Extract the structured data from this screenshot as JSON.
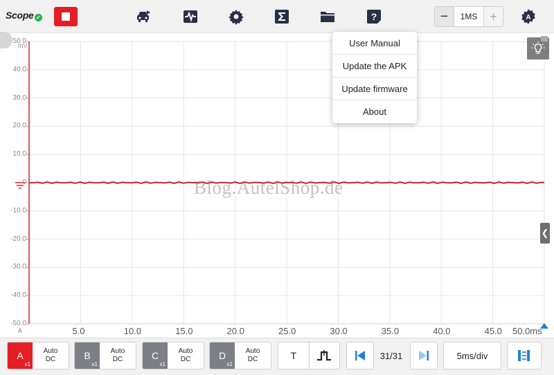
{
  "app": {
    "title": "Scope"
  },
  "colors": {
    "accent_red": "#e51d25",
    "trace": "#c8232c",
    "channel_gray": "#7d7f86",
    "icon_dark": "#2b2f45",
    "nav_blue": "#1f7fdc"
  },
  "toolbar": {
    "icons": [
      "stop-icon",
      "vehicle-icon",
      "waveform-icon",
      "gear-icon",
      "sigma-icon",
      "folder-icon",
      "help-icon",
      "settings-badge-icon"
    ],
    "sample_rate": {
      "minus": "−",
      "value": "1MS",
      "plus": "+"
    }
  },
  "help_menu": {
    "items": [
      "User Manual",
      "Update the APK",
      "Update firmware",
      "About"
    ]
  },
  "plot": {
    "y_unit": "mV",
    "y_ticks": [
      "50.0",
      "40.0",
      "30.0",
      "20.0",
      "10.0",
      "0",
      "-10.0",
      "-20.0",
      "-30.0",
      "-40.0",
      "-50.0"
    ],
    "x_ticks": [
      "5.0",
      "10.0",
      "15.0",
      "20.0",
      "25.0",
      "30.0",
      "35.0",
      "40.0",
      "45.0",
      "50.0ms"
    ],
    "axis_label": "A",
    "trace_level_mv": 0,
    "watermark": "Blog.AutelShop.de"
  },
  "channels": [
    {
      "name": "A",
      "mult": "x1",
      "mode_top": "Auto",
      "mode_bottom": "DC",
      "color": "#e51d25"
    },
    {
      "name": "B",
      "mult": "x1",
      "mode_top": "Auto",
      "mode_bottom": "DC",
      "color": "#7d7f86"
    },
    {
      "name": "C",
      "mult": "x1",
      "mode_top": "Auto",
      "mode_bottom": "DC",
      "color": "#7d7f86"
    },
    {
      "name": "D",
      "mult": "x1",
      "mode_top": "Auto",
      "mode_bottom": "DC",
      "color": "#7d7f86"
    }
  ],
  "bottom": {
    "trigger_label": "T",
    "frame_counter": "31/31",
    "timebase": "5ms/div"
  }
}
